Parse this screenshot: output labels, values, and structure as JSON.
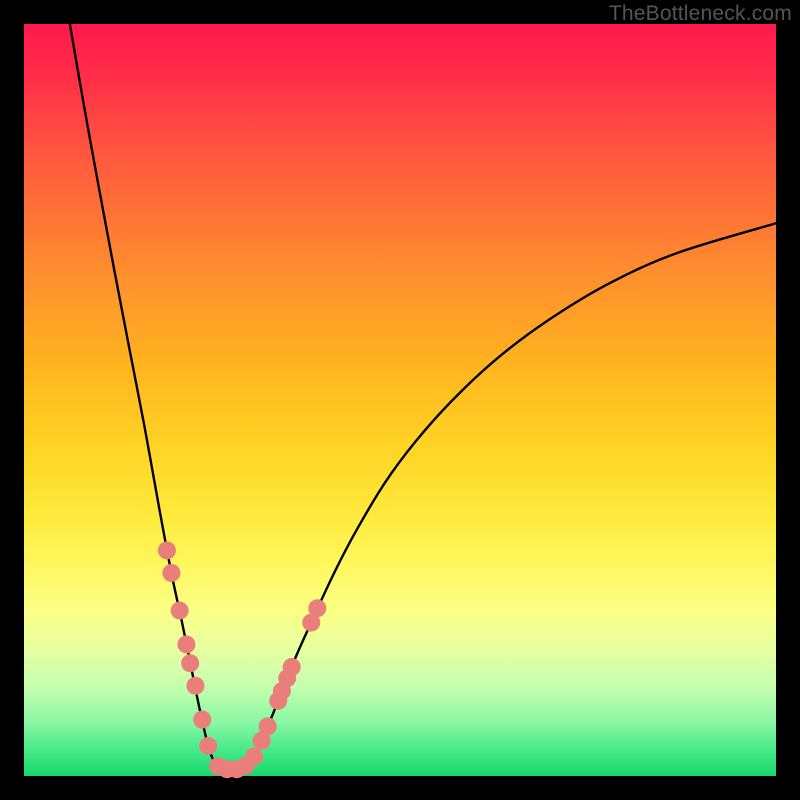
{
  "watermark": "TheBottleneck.com",
  "colors": {
    "frame": "#000000",
    "bead": "#e97e7b",
    "curve": "#000000",
    "gradient_top": "#ff1a4b",
    "gradient_bottom": "#17d76d"
  },
  "chart_data": {
    "type": "line",
    "title": "",
    "xlabel": "",
    "ylabel": "",
    "xlim": [
      0,
      100
    ],
    "ylim": [
      0,
      100
    ],
    "note": "Axes have no tick labels in the original image; x=0..100 spans the plot width left→right, y=0..100 spans the plot height bottom→top. Values are estimated from pixel positions.",
    "series": [
      {
        "name": "left-branch",
        "x": [
          6.1,
          8.0,
          10.0,
          12.0,
          14.0,
          16.0,
          18.0,
          19.6,
          21.0,
          22.0,
          23.0,
          24.0,
          24.5,
          25.0,
          25.6
        ],
        "y": [
          100.0,
          89.0,
          78.0,
          67.3,
          56.9,
          46.6,
          35.5,
          27.0,
          20.5,
          15.6,
          10.6,
          6.0,
          4.0,
          2.5,
          1.5
        ]
      },
      {
        "name": "trough",
        "x": [
          25.6,
          26.4,
          27.2,
          28.0,
          28.6,
          29.2,
          29.8,
          30.4,
          31.0
        ],
        "y": [
          1.5,
          1.0,
          0.9,
          0.9,
          1.0,
          1.2,
          1.6,
          2.2,
          3.2
        ]
      },
      {
        "name": "right-branch",
        "x": [
          31.0,
          32.0,
          33.0,
          34.0,
          36.0,
          38.0,
          41.0,
          44.0,
          48.0,
          52.0,
          57.0,
          63.0,
          70.0,
          78.0,
          87.0,
          100.0
        ],
        "y": [
          3.2,
          5.5,
          8.0,
          10.5,
          15.5,
          20.0,
          26.5,
          32.3,
          39.0,
          44.4,
          50.0,
          55.6,
          60.8,
          65.6,
          69.6,
          73.5
        ]
      }
    ],
    "beads_left": [
      {
        "x": 19.0,
        "y": 30.0
      },
      {
        "x": 19.6,
        "y": 27.0
      },
      {
        "x": 20.7,
        "y": 22.0
      },
      {
        "x": 21.6,
        "y": 17.5
      },
      {
        "x": 22.1,
        "y": 15.0
      },
      {
        "x": 22.8,
        "y": 12.0
      },
      {
        "x": 23.7,
        "y": 7.5
      },
      {
        "x": 24.5,
        "y": 4.0
      }
    ],
    "beads_trough": [
      {
        "x": 25.8,
        "y": 1.3
      },
      {
        "x": 27.0,
        "y": 0.9
      },
      {
        "x": 28.3,
        "y": 0.9
      },
      {
        "x": 29.5,
        "y": 1.4
      },
      {
        "x": 30.6,
        "y": 2.6
      }
    ],
    "beads_right": [
      {
        "x": 31.6,
        "y": 4.7
      },
      {
        "x": 32.4,
        "y": 6.6
      },
      {
        "x": 33.8,
        "y": 10.0
      },
      {
        "x": 34.3,
        "y": 11.3
      },
      {
        "x": 35.0,
        "y": 13.0
      },
      {
        "x": 35.6,
        "y": 14.5
      },
      {
        "x": 38.2,
        "y": 20.4
      },
      {
        "x": 39.0,
        "y": 22.3
      }
    ],
    "bead_radius_px": 9
  }
}
